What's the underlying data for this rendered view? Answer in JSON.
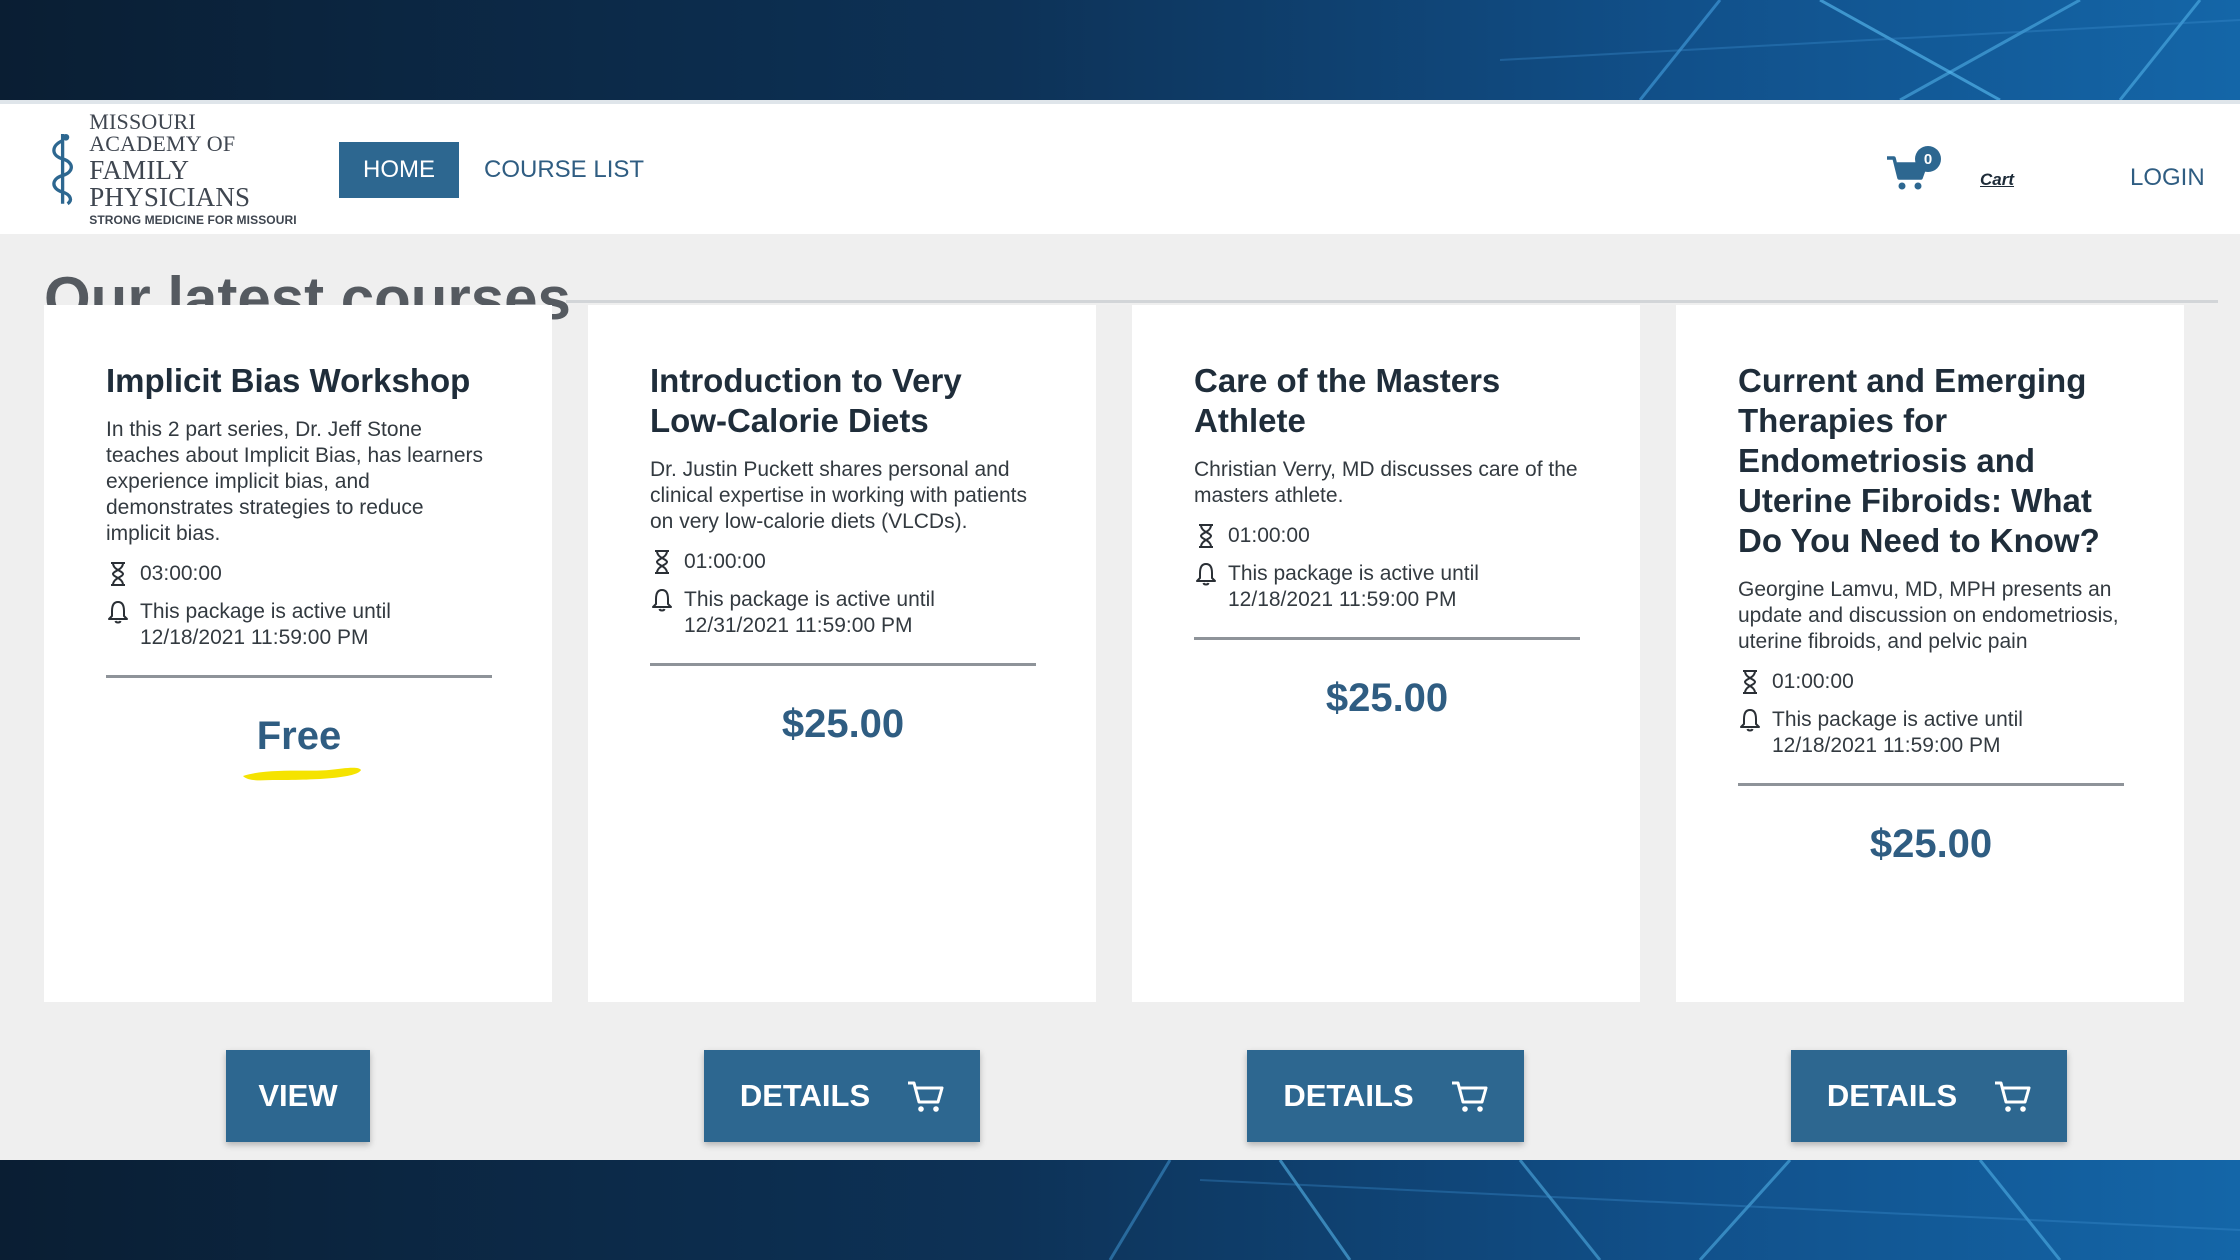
{
  "header": {
    "logo": {
      "line1": "MISSOURI ACADEMY OF",
      "line2": "FAMILY PHYSICIANS",
      "line3": "STRONG MEDICINE FOR MISSOURI"
    },
    "nav": {
      "home": "HOME",
      "course_list": "COURSE LIST"
    },
    "cart": {
      "count": "0",
      "label": "Cart"
    },
    "login": "LOGIN"
  },
  "section": {
    "title": "Our latest courses"
  },
  "cards": [
    {
      "title": "Implicit Bias Workshop",
      "description": "In this 2 part series, Dr. Jeff Stone teaches about Implicit Bias, has learners experience implicit bias, and demonstrates strategies to reduce implicit bias.",
      "duration": "03:00:00",
      "active_until": "This package is active until 12/18/2021 11:59:00 PM",
      "price": "Free",
      "button": "VIEW"
    },
    {
      "title": "Introduction to Very Low-Calorie Diets",
      "description": "Dr. Justin Puckett shares personal and clinical expertise in working with patients on very low-calorie diets (VLCDs).",
      "duration": "01:00:00",
      "active_until": "This package is active until 12/31/2021 11:59:00 PM",
      "price": "$25.00",
      "button": "DETAILS"
    },
    {
      "title": "Care of the Masters Athlete",
      "description": "Christian Verry, MD discusses care of the masters athlete.",
      "duration": "01:00:00",
      "active_until": "This package is active until 12/18/2021 11:59:00 PM",
      "price": "$25.00",
      "button": "DETAILS"
    },
    {
      "title": "Current and Emerging Therapies for Endometriosis and Uterine Fibroids: What Do You Need to Know?",
      "description": "Georgine Lamvu, MD, MPH presents an update and discussion on endometriosis, uterine fibroids, and pelvic pain",
      "duration": "01:00:00",
      "active_until": "This package is active until 12/18/2021 11:59:00 PM",
      "price": "$25.00",
      "button": "DETAILS"
    }
  ],
  "colors": {
    "accent": "#2d6790",
    "link": "#2f5d82",
    "page_bg": "#efefef",
    "highlight": "#f5e300"
  },
  "icons": [
    "caduceus-logo-icon",
    "shopping-cart-icon",
    "hourglass-icon",
    "bell-icon",
    "cart-outline-icon"
  ]
}
